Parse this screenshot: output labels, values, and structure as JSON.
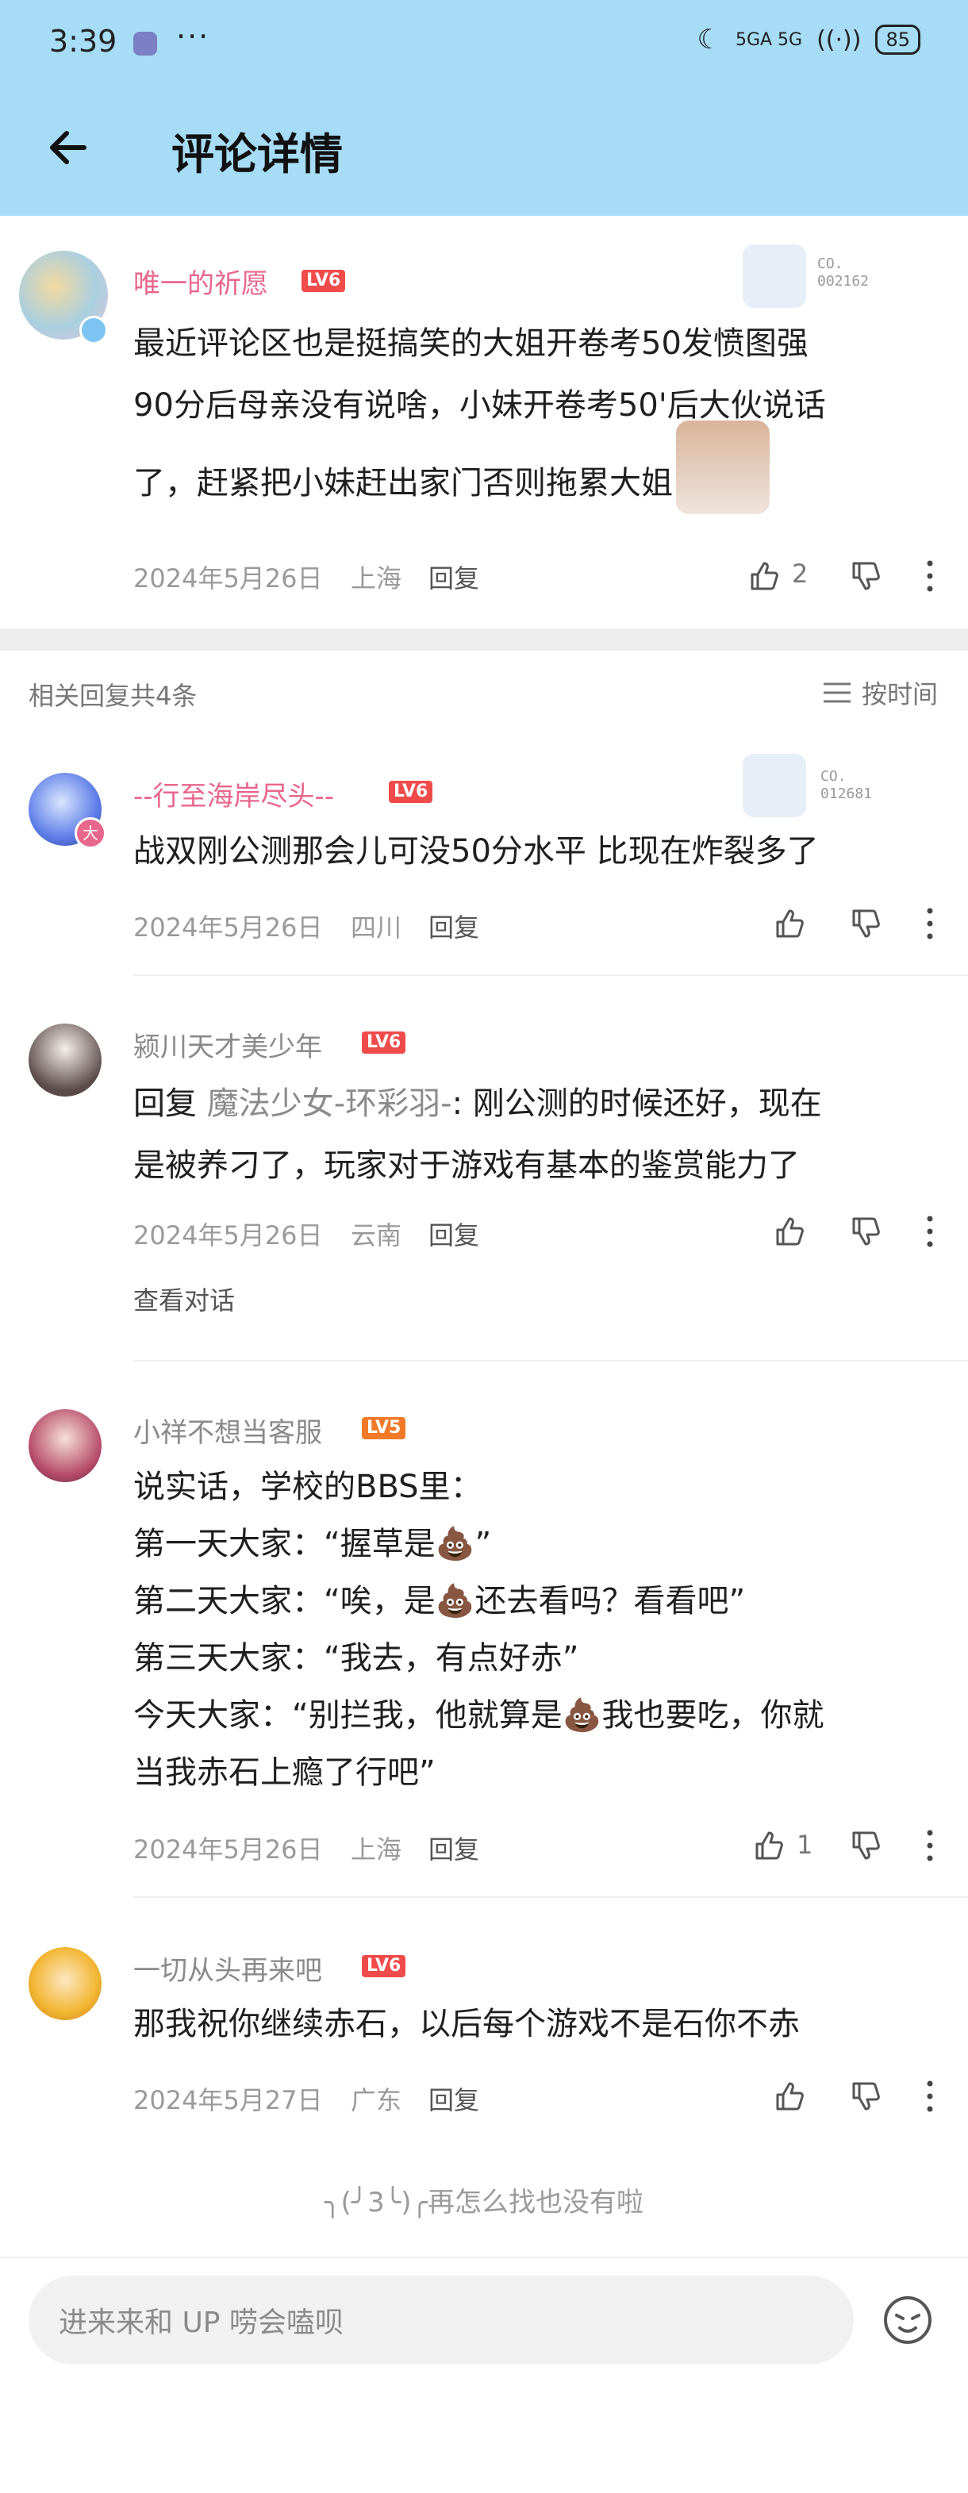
{
  "status_bar": {
    "time": "3:39",
    "network": "5GA  5G",
    "battery": "85"
  },
  "header": {
    "title": "评论详情"
  },
  "main_comment": {
    "username": "唯一的祈愿",
    "level": "LV6",
    "badge_line1": "CO.",
    "badge_line2": "002162",
    "text_line1": "最近评论区也是挺搞笑的大姐开卷考50发愤图强",
    "text_line2": "90分后母亲没有说啥，小妹开卷考50'后大伙说话",
    "text_line3": "了，赶紧把小妹赶出家门否则拖累大姐",
    "date": "2024年5月26日",
    "location": "上海",
    "reply_label": "回复",
    "like_count": "2"
  },
  "replies_header": {
    "count_label": "相关回复共4条",
    "sort_label": "按时间"
  },
  "replies": [
    {
      "username": "--行至海岸尽头--",
      "level": "LV6",
      "badge_line1": "CO.",
      "badge_line2": "012681",
      "lines": [
        "战双刚公测那会儿可没50分水平  比现在炸裂多了"
      ],
      "date": "2024年5月26日",
      "location": "四川",
      "reply_label": "回复"
    },
    {
      "username": "颍川天才美少年",
      "level": "LV6",
      "reply_prefix": "回复 ",
      "reply_target": "魔法少女-环彩羽-",
      "line1_rest": ": 刚公测的时候还好，现在",
      "line2": "是被养刁了，玩家对于游戏有基本的鉴赏能力了",
      "date": "2024年5月26日",
      "location": "云南",
      "reply_label": "回复",
      "view_conversation": "查看对话"
    },
    {
      "username": "小祥不想当客服",
      "level": "LV5",
      "line1": "说实话，学校的BBS里：",
      "line2a": "第一天大家：“握草是",
      "line2b": "”",
      "line3a": "第二天大家：“唉，是",
      "line3b": "还去看吗？看看吧”",
      "line4": "第三天大家：“我去，有点好赤”",
      "line5a": "今天大家：“别拦我，他就算是",
      "line5b": "我也要吃，你就",
      "line6": "当我赤石上瘾了行吧”",
      "date": "2024年5月26日",
      "location": "上海",
      "reply_label": "回复",
      "like_count": "1"
    },
    {
      "username": "一切从头再来吧",
      "level": "LV6",
      "lines": [
        "那我祝你继续赤石，以后每个游戏不是石你不赤"
      ],
      "date": "2024年5月27日",
      "location": "广东",
      "reply_label": "回复"
    }
  ],
  "end_text": "╮(╯3╰)╭再怎么找也没有啦",
  "input": {
    "placeholder": "进来来和 UP 唠会嗑呗"
  },
  "colors": {
    "header_bg": "#a6dcf5",
    "pink_name": "#e8678c",
    "level_red": "#f04b4b",
    "level_orange": "#f07a28"
  }
}
